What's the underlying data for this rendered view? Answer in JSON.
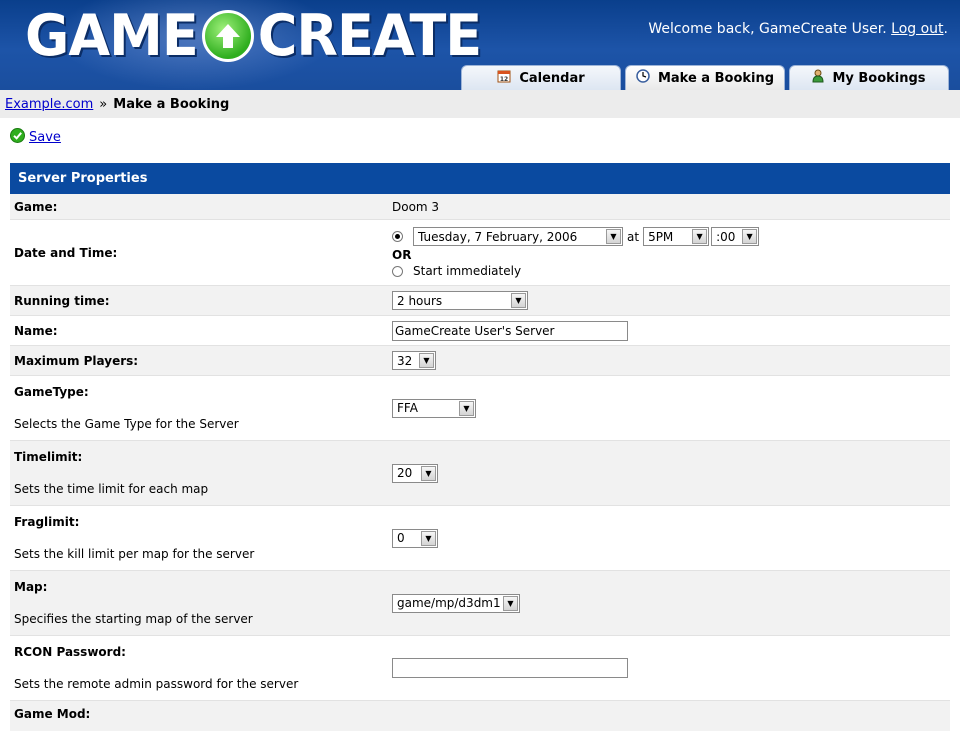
{
  "header": {
    "logo_left": "GAME",
    "logo_right": "CREATE",
    "welcome_text": "Welcome back, GameCreate User.",
    "logout_label": "Log out",
    "logout_suffix": "."
  },
  "tabs": [
    {
      "label": "Calendar",
      "icon": "calendar-icon"
    },
    {
      "label": "Make a Booking",
      "icon": "clock-icon"
    },
    {
      "label": "My Bookings",
      "icon": "user-icon"
    }
  ],
  "breadcrumb": {
    "home": "Example.com",
    "separator": "»",
    "current": "Make a Booking"
  },
  "toolbar": {
    "save_label": "Save"
  },
  "panel": {
    "title": "Server Properties",
    "game": {
      "label": "Game:",
      "value": "Doom 3"
    },
    "datetime": {
      "label": "Date and Time:",
      "date": "Tuesday, 7 February, 2006",
      "at": "at",
      "hour": "5PM",
      "minute": ":00",
      "or": "OR",
      "immediate": "Start immediately"
    },
    "running_time": {
      "label": "Running time:",
      "value": "2 hours"
    },
    "name": {
      "label": "Name:",
      "value": "GameCreate User's Server"
    },
    "max_players": {
      "label": "Maximum Players:",
      "value": "32"
    },
    "gametype": {
      "label": "GameType:",
      "desc": "Selects the Game Type for the Server",
      "value": "FFA"
    },
    "timelimit": {
      "label": "Timelimit:",
      "desc": "Sets the time limit for each map",
      "value": "20"
    },
    "fraglimit": {
      "label": "Fraglimit:",
      "desc": "Sets the kill limit per map for the server",
      "value": "0"
    },
    "map": {
      "label": "Map:",
      "desc": "Specifies the starting map of the server",
      "value": "game/mp/d3dm1"
    },
    "rcon": {
      "label": "RCON Password:",
      "desc": "Sets the remote admin password for the server",
      "value": ""
    },
    "gamemod": {
      "label": "Game Mod:"
    }
  },
  "colors": {
    "header_blue": "#1d54a8",
    "panel_head_blue": "#0a4aa0",
    "link_blue": "#0000cc",
    "save_green": "#2fae1e"
  }
}
